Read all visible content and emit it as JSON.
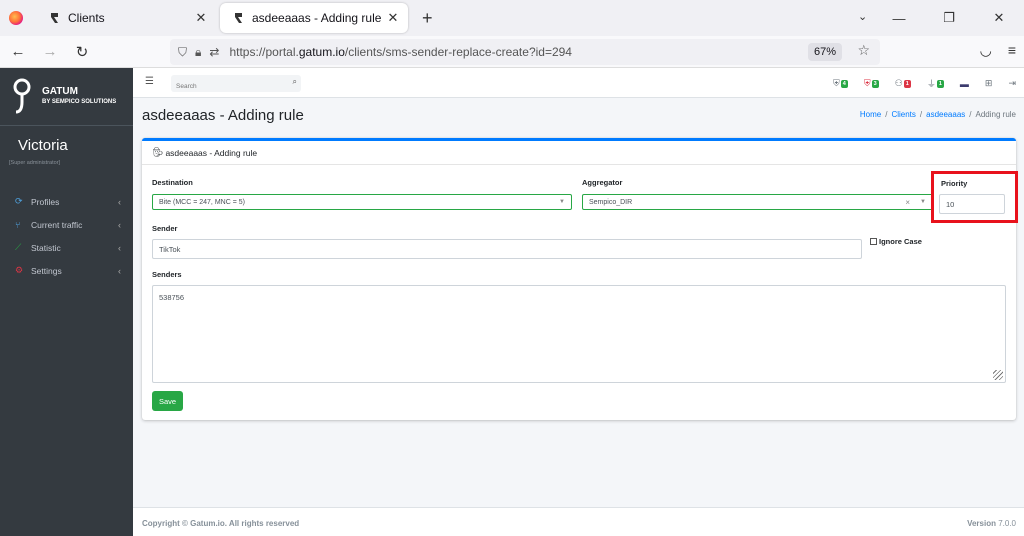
{
  "browser": {
    "tabs": [
      {
        "title": "Clients",
        "active": false
      },
      {
        "title": "asdeeaaas - Adding rule",
        "active": true
      }
    ],
    "url_prefix": "https://portal.",
    "url_domain": "gatum.io",
    "url_path": "/clients/sms-sender-replace-create?id=294",
    "zoom": "67%"
  },
  "sidebar": {
    "brand_name": "GATUM",
    "brand_tagline": "BY SEMPICO SOLUTIONS",
    "user_name": "Victoria",
    "user_role": "[Super administrator]",
    "items": [
      {
        "label": "Profiles",
        "icon": "refresh-icon",
        "color": "#4fa3e0"
      },
      {
        "label": "Current traffic",
        "icon": "branch-icon",
        "color": "#4fa3e0"
      },
      {
        "label": "Statistic",
        "icon": "chart-icon",
        "color": "#28a745"
      },
      {
        "label": "Settings",
        "icon": "gears-icon",
        "color": "#dc3545"
      }
    ]
  },
  "header": {
    "search_placeholder": "Search",
    "badges": [
      {
        "icon": "shield-check-icon",
        "count": "4",
        "color": "green"
      },
      {
        "icon": "shield-alert-icon",
        "count": "3",
        "color": "green"
      },
      {
        "icon": "users-icon",
        "count": "1",
        "color": "red"
      },
      {
        "icon": "plug-icon",
        "count": "1",
        "color": "green"
      }
    ]
  },
  "page": {
    "title": "asdeeaaas - Adding rule",
    "breadcrumb": [
      "Home",
      "Clients",
      "asdeeaaas",
      "Adding rule"
    ]
  },
  "form": {
    "card_title": "asdeeaaas - Adding rule",
    "destination_label": "Destination",
    "destination_value": "Bite (MCC = 247, MNC = 5)",
    "aggregator_label": "Aggregator",
    "aggregator_value": "Sempico_DIR",
    "priority_label": "Priority",
    "priority_value": "10",
    "sender_label": "Sender",
    "sender_value": "TikTok",
    "ignore_case_label": "Ignore Case",
    "senders_label": "Senders",
    "senders_value": "538756",
    "save_label": "Save"
  },
  "footer": {
    "copyright": "Copyright © Gatum.io. All rights reserved",
    "version_label": "Version",
    "version_value": "7.0.0"
  },
  "colors": {
    "accent": "#007bff",
    "success": "#28a745",
    "danger": "#dc3545",
    "highlight": "#e8121c",
    "sidebar_bg": "#343a40"
  }
}
